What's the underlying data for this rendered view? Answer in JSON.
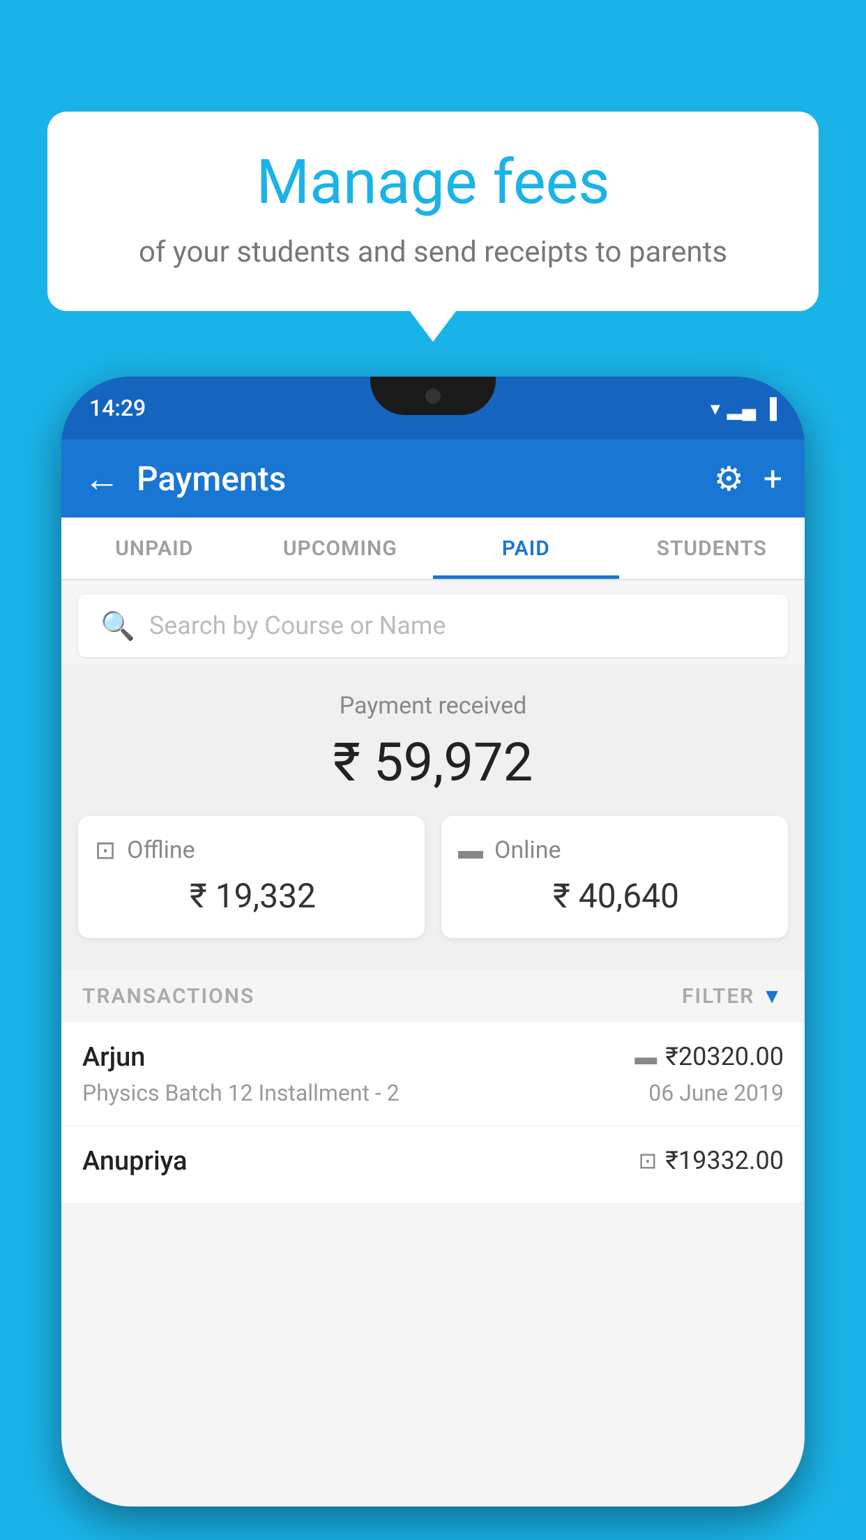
{
  "background_color": "#1ab3e8",
  "bubble": {
    "title": "Manage fees",
    "subtitle": "of your students and send receipts to parents"
  },
  "phone": {
    "status_bar": {
      "time": "14:29",
      "icons": [
        "▾▾",
        "◂▸",
        "▐"
      ]
    },
    "app_bar": {
      "back_icon": "←",
      "title": "Payments",
      "settings_icon": "⚙",
      "add_icon": "+"
    },
    "tabs": [
      {
        "label": "UNPAID",
        "active": false
      },
      {
        "label": "UPCOMING",
        "active": false
      },
      {
        "label": "PAID",
        "active": true
      },
      {
        "label": "STUDENTS",
        "active": false
      }
    ],
    "search": {
      "placeholder": "Search by Course or Name",
      "icon": "🔍"
    },
    "payment_summary": {
      "label": "Payment received",
      "amount": "₹ 59,972",
      "offline": {
        "label": "Offline",
        "amount": "₹ 19,332",
        "icon": "▣"
      },
      "online": {
        "label": "Online",
        "amount": "₹ 40,640",
        "icon": "▬"
      }
    },
    "transactions_header": {
      "label": "TRANSACTIONS",
      "filter_label": "FILTER",
      "filter_icon": "▼"
    },
    "transactions": [
      {
        "name": "Arjun",
        "amount": "₹20320.00",
        "amount_icon": "▬",
        "course": "Physics Batch 12 Installment - 2",
        "date": "06 June 2019"
      },
      {
        "name": "Anupriya",
        "amount": "₹19332.00",
        "amount_icon": "▣",
        "course": "",
        "date": ""
      }
    ]
  }
}
